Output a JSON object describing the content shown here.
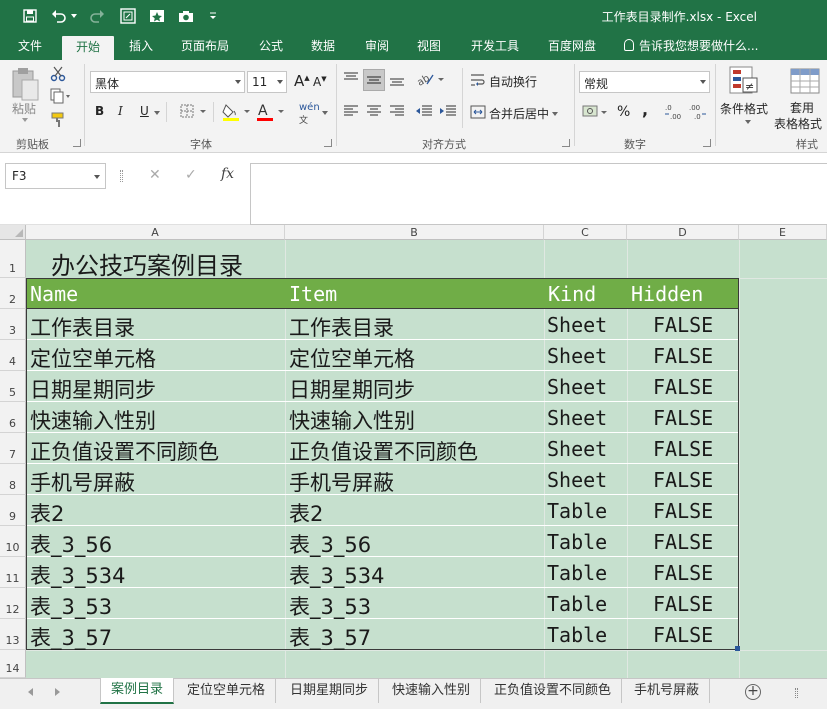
{
  "window": {
    "title": "工作表目录制作.xlsx - Excel"
  },
  "quick_access": {
    "icons": [
      "save-icon",
      "undo-icon",
      "redo-icon",
      "screenshot-icon",
      "camera-icon",
      "customize-icon"
    ]
  },
  "ribbon_tabs": [
    "文件",
    "开始",
    "插入",
    "页面布局",
    "公式",
    "数据",
    "审阅",
    "视图",
    "开发工具",
    "百度网盘"
  ],
  "active_tab": "开始",
  "tell_me": "告诉我您想要做什么...",
  "ribbon": {
    "clipboard": {
      "paste_label": "粘贴",
      "group_label": "剪贴板"
    },
    "font": {
      "font_name": "黑体",
      "font_size": "11",
      "bold": "B",
      "italic": "I",
      "underline": "U",
      "group_label": "字体",
      "phonetic": "wén"
    },
    "alignment": {
      "wrap_text": "自动换行",
      "merge_center": "合并后居中",
      "group_label": "对齐方式"
    },
    "number": {
      "format": "常规",
      "percent": "%",
      "comma": ",",
      "group_label": "数字"
    },
    "styles": {
      "conditional_format": "条件格式",
      "table_format_line1": "套用",
      "table_format_line2": "表格格式",
      "group_label": "样式"
    },
    "colors": {
      "accent": "#217346",
      "font_color_bar": "#ff0000",
      "fill_color_bar": "#ffff00"
    }
  },
  "formula_bar": {
    "name_box": "F3",
    "cancel_symbol": "✕",
    "enter_symbol": "✓",
    "fx_label": "fx",
    "formula": ""
  },
  "columns": [
    "A",
    "B",
    "C",
    "D",
    "E"
  ],
  "rows": [
    "1",
    "2",
    "3",
    "4",
    "5",
    "6",
    "7",
    "8",
    "9",
    "10",
    "11",
    "12",
    "13",
    "14"
  ],
  "sheet_title": "办公技巧案例目录",
  "table": {
    "headers": [
      "Name",
      "Item",
      "Kind",
      "Hidden"
    ],
    "header_color": "#70ad47",
    "rows": [
      [
        "工作表目录",
        "工作表目录",
        "Sheet",
        "FALSE"
      ],
      [
        "定位空单元格",
        "定位空单元格",
        "Sheet",
        "FALSE"
      ],
      [
        "日期星期同步",
        "日期星期同步",
        "Sheet",
        "FALSE"
      ],
      [
        "快速输入性别",
        "快速输入性别",
        "Sheet",
        "FALSE"
      ],
      [
        "正负值设置不同颜色",
        "正负值设置不同颜色",
        "Sheet",
        "FALSE"
      ],
      [
        "手机号屏蔽",
        "手机号屏蔽",
        "Sheet",
        "FALSE"
      ],
      [
        "表2",
        "表2",
        "Table",
        "FALSE"
      ],
      [
        "表_3_56",
        "表_3_56",
        "Table",
        "FALSE"
      ],
      [
        "表_3_534",
        "表_3_534",
        "Table",
        "FALSE"
      ],
      [
        "表_3_53",
        "表_3_53",
        "Table",
        "FALSE"
      ],
      [
        "表_3_57",
        "表_3_57",
        "Table",
        "FALSE"
      ]
    ]
  },
  "sheet_tabs": [
    "案例目录",
    "定位空单元格",
    "日期星期同步",
    "快速输入性别",
    "正负值设置不同颜色",
    "手机号屏蔽"
  ],
  "active_sheet": "案例目录",
  "add_sheet_symbol": "+"
}
